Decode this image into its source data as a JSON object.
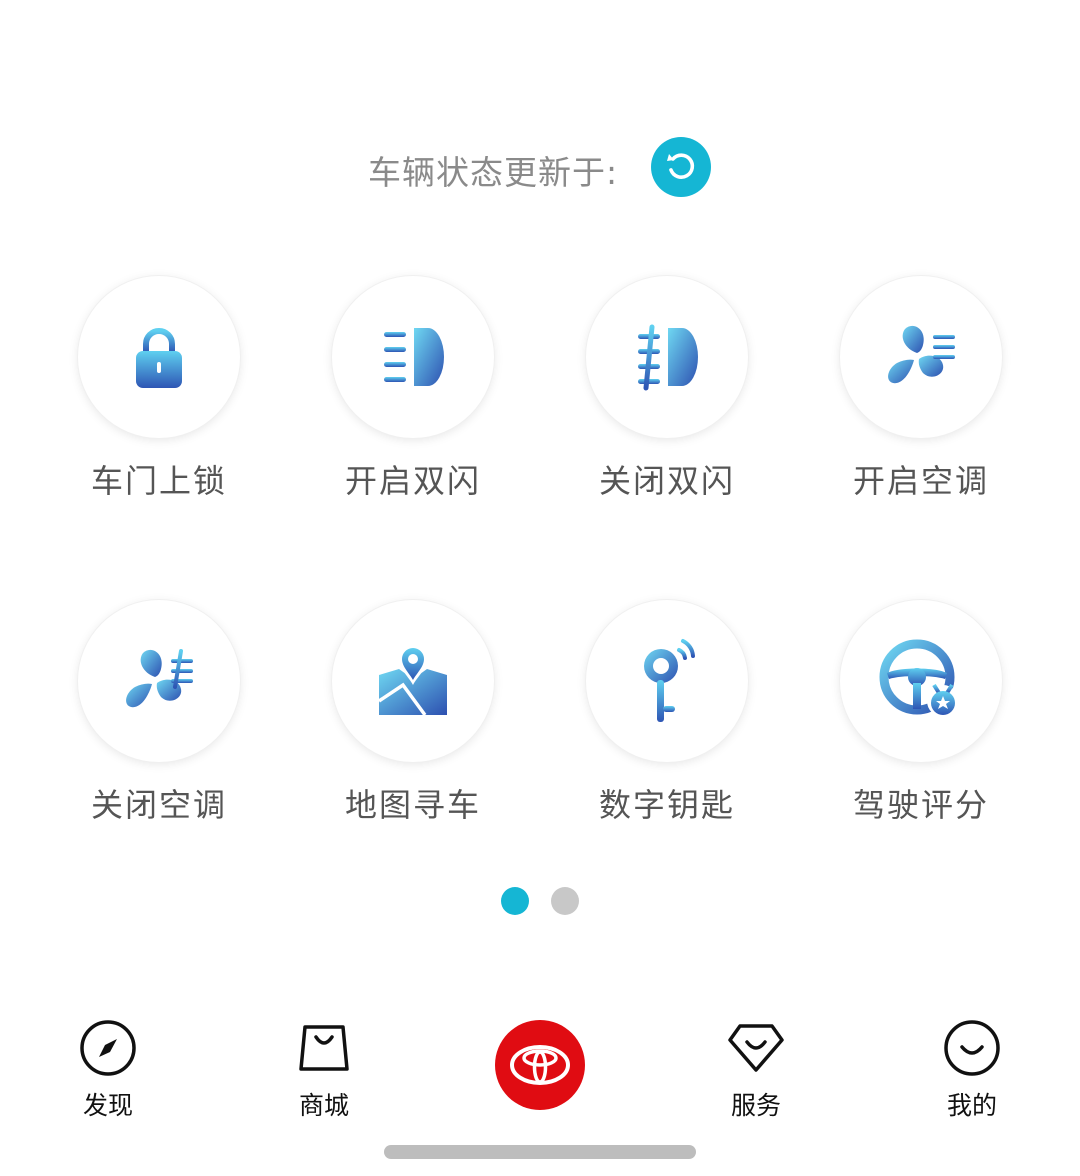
{
  "status": {
    "label": "车辆状态更新于:",
    "refresh_icon": "refresh-icon",
    "accent_color": "#15b6d4"
  },
  "controls": [
    {
      "label": "车门上锁",
      "icon": "lock-icon"
    },
    {
      "label": "开启双闪",
      "icon": "headlight-on-icon"
    },
    {
      "label": "关闭双闪",
      "icon": "headlight-off-icon"
    },
    {
      "label": "开启空调",
      "icon": "ac-on-icon"
    },
    {
      "label": "关闭空调",
      "icon": "ac-off-icon"
    },
    {
      "label": "地图寻车",
      "icon": "map-pin-icon"
    },
    {
      "label": "数字钥匙",
      "icon": "digital-key-icon"
    },
    {
      "label": "驾驶评分",
      "icon": "steering-wheel-badge-icon"
    }
  ],
  "pager": {
    "pages": 2,
    "current": 1
  },
  "tabbar": {
    "items": [
      {
        "label": "发现",
        "icon": "compass-icon"
      },
      {
        "label": "商城",
        "icon": "shopping-bag-icon"
      },
      {
        "label": "",
        "icon": "toyota-logo-icon"
      },
      {
        "label": "服务",
        "icon": "diamond-icon"
      },
      {
        "label": "我的",
        "icon": "smile-icon"
      }
    ],
    "home_color": "#e00c12"
  }
}
